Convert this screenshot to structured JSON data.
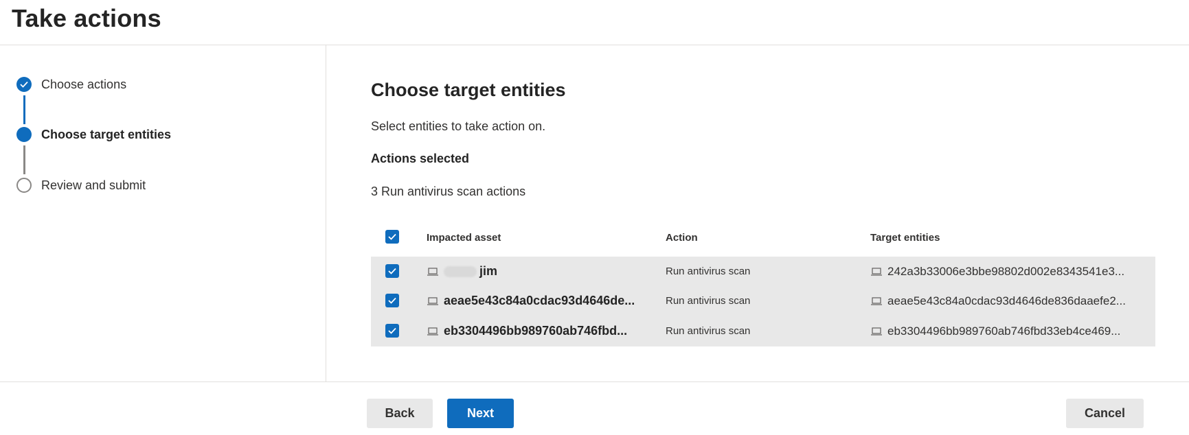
{
  "header": {
    "title": "Take actions"
  },
  "steps": [
    {
      "label": "Choose actions",
      "state": "done"
    },
    {
      "label": "Choose target entities",
      "state": "current"
    },
    {
      "label": "Review and submit",
      "state": "todo"
    }
  ],
  "main": {
    "title": "Choose target entities",
    "description": "Select entities to take action on.",
    "actions_heading": "Actions selected",
    "actions_summary": "3 Run antivirus scan actions"
  },
  "table": {
    "columns": {
      "asset": "Impacted asset",
      "action": "Action",
      "target": "Target entities"
    },
    "select_all_checked": true,
    "rows": [
      {
        "checked": true,
        "asset": "jim",
        "asset_redacted": true,
        "action": "Run antivirus scan",
        "target": "242a3b33006e3bbe98802d002e8343541e3..."
      },
      {
        "checked": true,
        "asset": "aeae5e43c84a0cdac93d4646de...",
        "asset_redacted": false,
        "action": "Run antivirus scan",
        "target": "aeae5e43c84a0cdac93d4646de836daaefe2..."
      },
      {
        "checked": true,
        "asset": "eb3304496bb989760ab746fbd...",
        "asset_redacted": false,
        "action": "Run antivirus scan",
        "target": "eb3304496bb989760ab746fbd33eb4ce469..."
      }
    ]
  },
  "footer": {
    "back_label": "Back",
    "next_label": "Next",
    "cancel_label": "Cancel"
  },
  "colors": {
    "accent": "#0f6cbd",
    "row_bg": "#e8e8e8",
    "button_secondary": "#e8e8e8"
  },
  "icons": {
    "step_done": "checkmark-icon",
    "row_asset": "laptop-icon",
    "row_target": "laptop-icon"
  }
}
